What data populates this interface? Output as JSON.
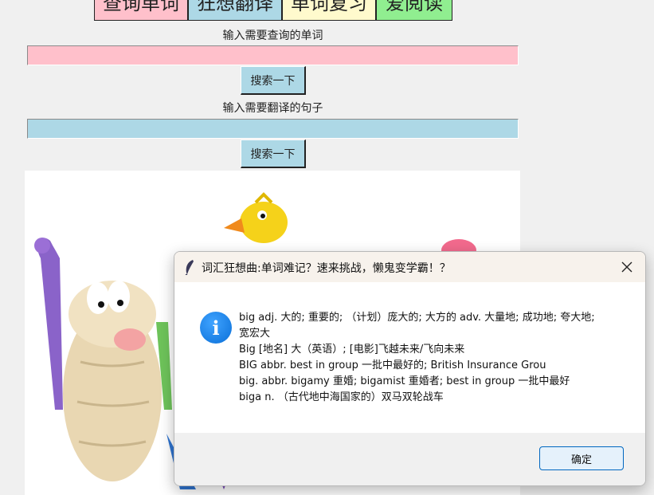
{
  "tabs": [
    {
      "label": "查询单词",
      "color": "#ffc0cb"
    },
    {
      "label": "狂想翻译",
      "color": "#add8e6"
    },
    {
      "label": "单词复习",
      "color": "#fffacd"
    },
    {
      "label": "爱阅读",
      "color": "#90ee90"
    }
  ],
  "word_search": {
    "label": "输入需要查询的单词",
    "value": "",
    "button": "搜索一下",
    "field_color": "#ffc0cb"
  },
  "sentence_translate": {
    "label": "输入需要翻译的句子",
    "value": "",
    "button": "搜索一下",
    "field_color": "#add8e6"
  },
  "dialog": {
    "title": "词汇狂想曲:单词难记？速来挑战，懒鬼变学霸！？",
    "icon": "info-icon",
    "message_lines": [
      "big adj. 大的; 重要的; （计划）庞大的; 大方的 adv. 大量地; 成功地; 夸大地;",
      "宽宏大",
      "Big [地名] 大（英语）; [电影]飞越未来/飞向未来",
      "BIG abbr. best in group 一批中最好的; British Insurance Grou",
      "big. abbr. bigamy 重婚; bigamist 重婚者; best in group 一批中最好",
      "biga n. （古代地中海国家的）双马双轮战车"
    ],
    "ok_label": "确定"
  }
}
